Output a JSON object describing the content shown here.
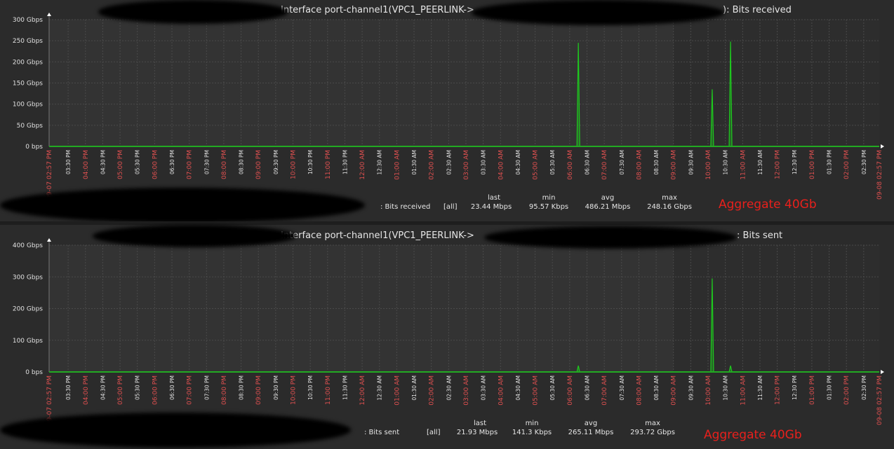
{
  "graphs": [
    {
      "title_prefix": "Interface port-channel1(VPC1_PEERLINK->",
      "title_suffix": "): Bits received",
      "y_ticks": [
        "0 bps",
        "50 Gbps",
        "100 Gbps",
        "150 Gbps",
        "200 Gbps",
        "250 Gbps",
        "300 Gbps"
      ],
      "y_max": 300,
      "legend": {
        "item": ": Bits received",
        "func": "[all]",
        "headers": [
          "last",
          "min",
          "avg",
          "max"
        ],
        "values": [
          "23.44 Mbps",
          "95.57 Kbps",
          "486.21 Mbps",
          "248.16 Gbps"
        ]
      },
      "note": "Aggregate 40Gb",
      "series_color": "#1ec81e",
      "spikes": [
        [
          15.3,
          245
        ],
        [
          19.17,
          135
        ],
        [
          19.7,
          248
        ]
      ]
    },
    {
      "title_prefix": "Interface port-channel1(VPC1_PEERLINK->",
      "title_suffix": ": Bits sent",
      "y_ticks": [
        "0 bps",
        "100 Gbps",
        "200 Gbps",
        "300 Gbps",
        "400 Gbps"
      ],
      "y_max": 400,
      "legend": {
        "item": ": Bits sent",
        "func": "[all]",
        "headers": [
          "last",
          "min",
          "avg",
          "max"
        ],
        "values": [
          "21.93 Mbps",
          "141.3 Kbps",
          "265.11 Mbps",
          "293.72 Gbps"
        ]
      },
      "note": "Aggregate 40Gb",
      "series_color": "#1ec81e",
      "spikes": [
        [
          15.3,
          20
        ],
        [
          19.17,
          295
        ],
        [
          19.7,
          20
        ]
      ]
    }
  ],
  "x_axis": {
    "start_label": "09-07 02:57 PM",
    "end_label": "09-08 02:57 PM",
    "ticks": [
      "03:30 PM",
      "04:00 PM",
      "04:30 PM",
      "05:00 PM",
      "05:30 PM",
      "06:00 PM",
      "06:30 PM",
      "07:00 PM",
      "07:30 PM",
      "08:00 PM",
      "08:30 PM",
      "09:00 PM",
      "09:30 PM",
      "10:00 PM",
      "10:30 PM",
      "11:00 PM",
      "11:30 PM",
      "12:00 AM",
      "12:30 AM",
      "01:00 AM",
      "01:30 AM",
      "02:00 AM",
      "02:30 AM",
      "03:00 AM",
      "03:30 AM",
      "04:00 AM",
      "04:30 AM",
      "05:00 AM",
      "05:30 AM",
      "06:00 AM",
      "06:30 AM",
      "07:00 AM",
      "07:30 AM",
      "08:00 AM",
      "08:30 AM",
      "09:00 AM",
      "09:30 AM",
      "10:00 AM",
      "10:30 AM",
      "11:00 AM",
      "11:30 AM",
      "12:00 PM",
      "12:30 PM",
      "01:00 PM",
      "01:30 PM",
      "02:00 PM",
      "02:30 PM"
    ],
    "hour_color": "#e05050",
    "half_color": "#e6e6e6"
  }
}
